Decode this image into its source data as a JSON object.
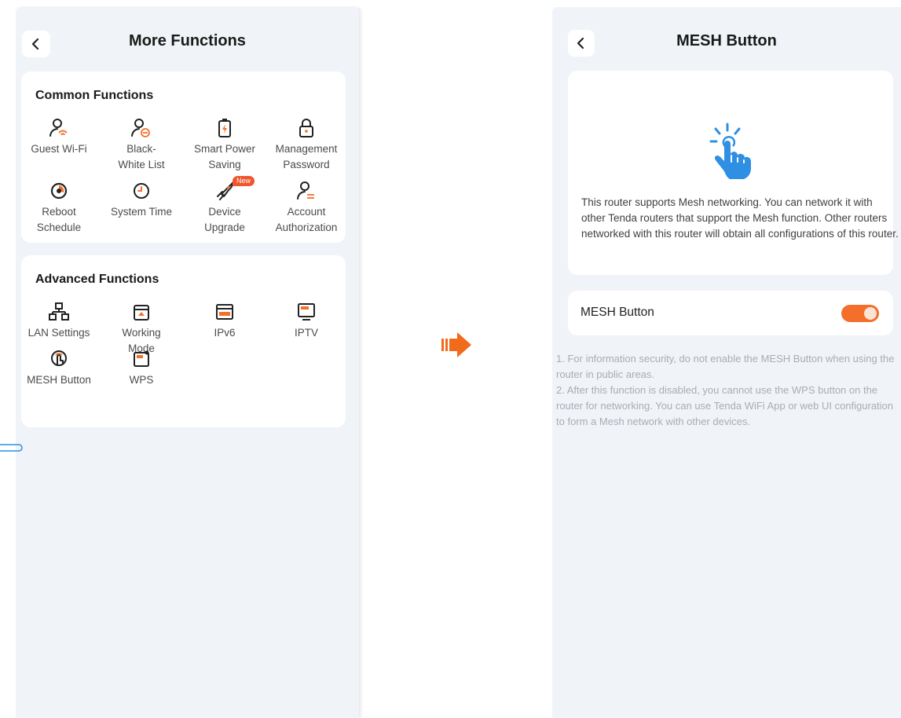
{
  "left_screen": {
    "title": "More Functions",
    "common": {
      "title": "Common Functions",
      "items": [
        {
          "label": "Guest Wi-Fi",
          "icon": "guest-wifi-icon"
        },
        {
          "label": "Black-\nWhite List",
          "icon": "blacklist-icon"
        },
        {
          "label": "Smart Power\nSaving",
          "icon": "battery-icon"
        },
        {
          "label": "Management\nPassword",
          "icon": "lock-icon"
        },
        {
          "label": "Reboot\nSchedule",
          "icon": "reboot-icon"
        },
        {
          "label": "System Time",
          "icon": "clock-icon"
        },
        {
          "label": "Device\nUpgrade",
          "icon": "rocket-icon",
          "badge": "New"
        },
        {
          "label": "Account\nAuthorization",
          "icon": "account-icon"
        }
      ]
    },
    "advanced": {
      "title": "Advanced Functions",
      "items": [
        {
          "label": "LAN Settings",
          "icon": "lan-icon"
        },
        {
          "label": "Working\nMode",
          "icon": "working-mode-icon"
        },
        {
          "label": "IPv6",
          "icon": "ipv6-icon"
        },
        {
          "label": "IPTV",
          "icon": "iptv-icon"
        },
        {
          "label": "MESH Button",
          "icon": "mesh-icon"
        },
        {
          "label": "WPS",
          "icon": "wps-icon"
        }
      ]
    }
  },
  "right_screen": {
    "title": "MESH Button",
    "description": "This router supports Mesh networking. You can network it with other Tenda routers that support the Mesh function. Other routers networked with this router will obtain all configurations of this router.",
    "toggle_label": "MESH Button",
    "toggle_on": true,
    "notes": "1. For information security, do not enable the MESH Button when using the router in public areas.\n2. After this function is disabled, you cannot use the WPS button on the router for networking. You can use Tenda WiFi App or web UI configuration to form a Mesh network with other devices."
  },
  "colors": {
    "accent": "#f36f2b",
    "icon_blue": "#2f8fe3",
    "background": "#f0f3f7"
  }
}
